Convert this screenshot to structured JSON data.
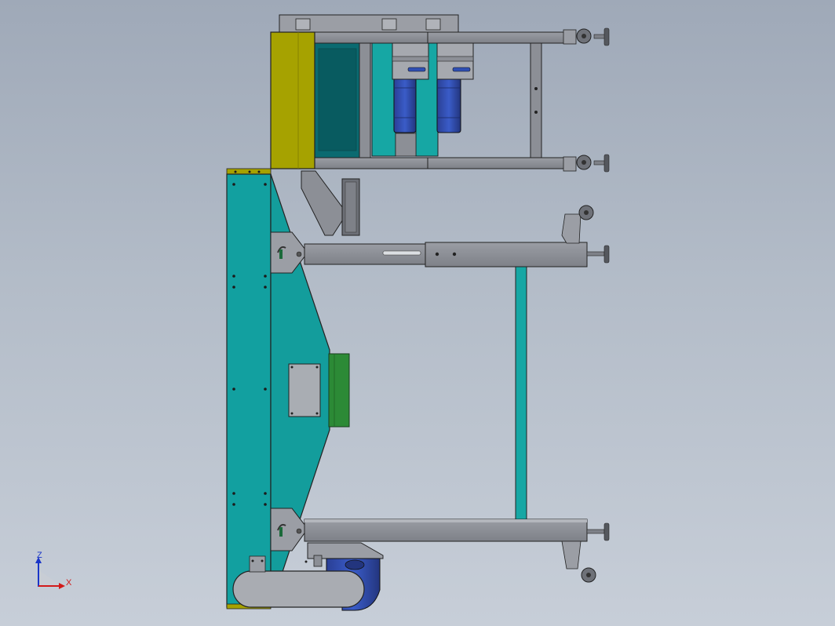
{
  "triad": {
    "z_label": "Z",
    "x_label": "X",
    "z_color": "#1a35c8",
    "x_color": "#d21a1a"
  },
  "colors": {
    "background_top": "#9fa9b8",
    "background_bottom": "#c7ced8",
    "frame_grey": "#8c8f96",
    "teal": "#12a0a0",
    "teal_dark": "#0b7f80",
    "olive": "#a6a200",
    "green": "#2c8a36",
    "motor_blue": "#2f4fb3",
    "outline": "#222222"
  }
}
